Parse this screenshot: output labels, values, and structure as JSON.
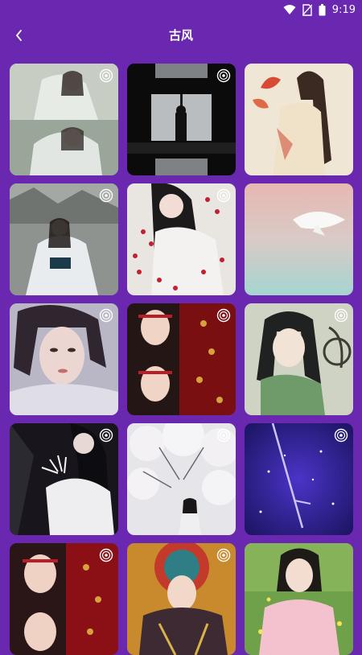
{
  "status_bar": {
    "time": "9:19",
    "icons": [
      "wifi-icon",
      "no-sim-icon",
      "battery-icon"
    ]
  },
  "header": {
    "title": "古风",
    "back_icon": "chevron-left-icon"
  },
  "colors": {
    "background": "#6a28b0",
    "text": "#ffffff"
  },
  "wallpapers": [
    {
      "badge": "live-wallpaper-icon"
    },
    {
      "badge": "live-wallpaper-icon"
    },
    {
      "badge": null
    },
    {
      "badge": "live-wallpaper-icon"
    },
    {
      "badge": "live-wallpaper-icon"
    },
    {
      "badge": null
    },
    {
      "badge": "live-wallpaper-icon"
    },
    {
      "badge": "live-wallpaper-icon"
    },
    {
      "badge": "live-wallpaper-icon"
    },
    {
      "badge": "live-wallpaper-icon"
    },
    {
      "badge": "live-wallpaper-icon"
    },
    {
      "badge": "live-wallpaper-icon"
    },
    {
      "badge": "live-wallpaper-icon"
    },
    {
      "badge": "live-wallpaper-icon"
    },
    {
      "badge": null
    }
  ]
}
